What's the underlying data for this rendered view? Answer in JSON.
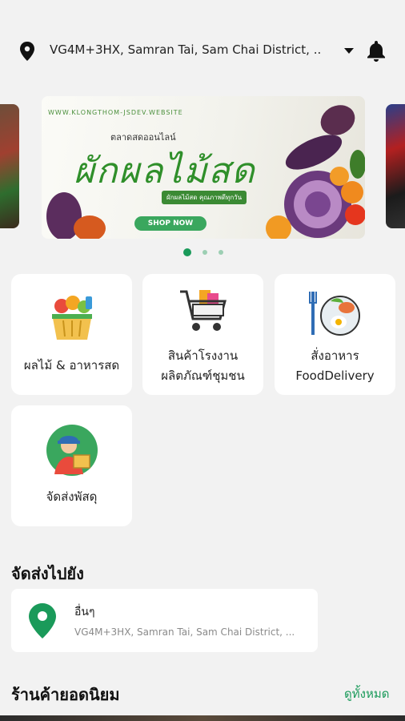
{
  "header": {
    "location_text": "VG4M+3HX, Samran Tai, Sam Chai District, ...",
    "location_icon": "map-pin-icon",
    "dropdown_icon": "caret-down-icon",
    "notification_icon": "bell-icon"
  },
  "banner": {
    "url": "WWW.KLONGTHOM-JSDEV.WEBSITE",
    "subtitle": "ตลาดสดออนไลน์",
    "title": "ผักผลไม้สด",
    "tagline": "ผักผลไม้สด คุณภาพดีทุกวัน",
    "button": "SHOP NOW"
  },
  "carousel": {
    "page_count": 3,
    "active_index": 0
  },
  "categories": [
    {
      "label": "ผลไม้ & อาหารสด",
      "icon": "fruit-basket-icon"
    },
    {
      "label_line1": "สินค้าโรงงาน",
      "label_line2": "ผลิตภัณฑ์ชุมชน",
      "icon": "shopping-cart-icon"
    },
    {
      "label_line1": "สั่งอาหาร",
      "label_line2": "FoodDelivery",
      "icon": "food-plate-icon"
    },
    {
      "label": "จัดส่งพัสดุ",
      "icon": "delivery-man-icon"
    }
  ],
  "delivery": {
    "section_title": "จัดส่งไปยัง",
    "name": "อื่นๆ",
    "address": "VG4M+3HX, Samran Tai, Sam Chai District, ..."
  },
  "popular": {
    "section_title": "ร้านค้ายอดนิยม",
    "see_all": "ดูทั้งหมด"
  },
  "colors": {
    "accent": "#1a9a5a",
    "background": "#f2f2f2"
  }
}
